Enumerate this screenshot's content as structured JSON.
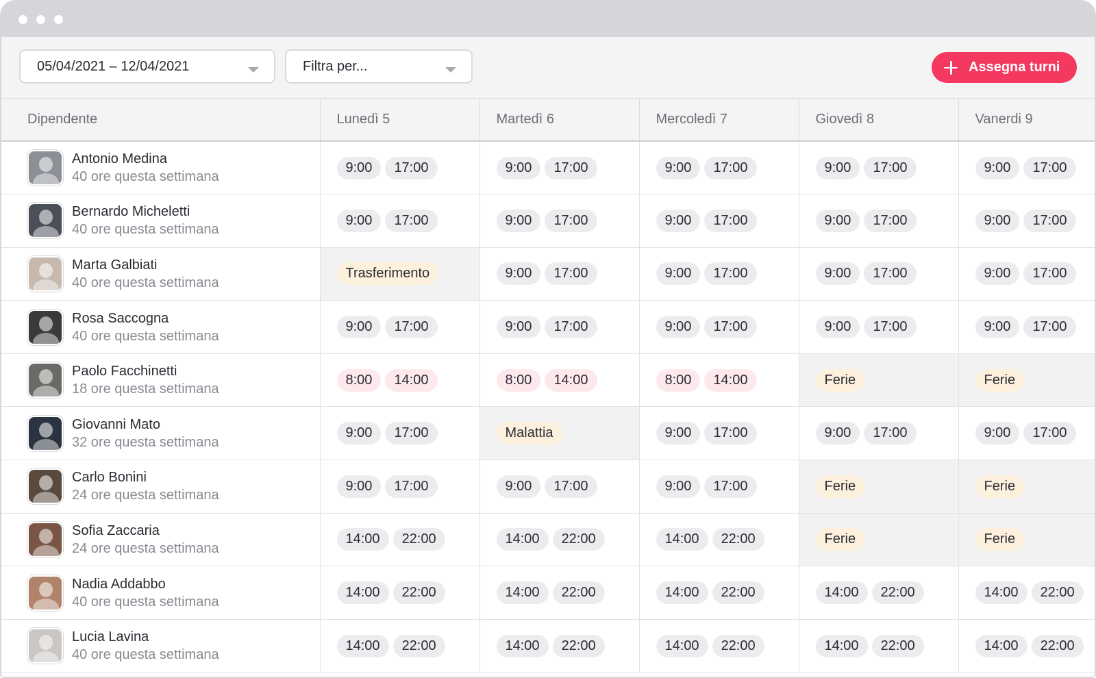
{
  "toolbar": {
    "date_range": "05/04/2021 – 12/04/2021",
    "filter_placeholder": "Filtra per...",
    "assign_label": "Assegna turni"
  },
  "colors": {
    "accent": "#f5385f",
    "pill_default": "#ececee",
    "pill_pink": "#fde8ec",
    "pill_cream": "#fdf1dd",
    "shaded_cell": "#f2f2f3"
  },
  "table": {
    "employee_header": "Dipendente",
    "days": [
      "Lunedì 5",
      "Martedì 6",
      "Mercoledì 7",
      "Giovedì 8",
      "Vanerdi 9"
    ],
    "employees": [
      {
        "name": "Antonio Medina",
        "hours": "40 ore questa settimana",
        "avatar": "avatar-photo-antonio",
        "cells": [
          [
            "9:00",
            "17:00"
          ],
          [
            "9:00",
            "17:00"
          ],
          [
            "9:00",
            "17:00"
          ],
          [
            "9:00",
            "17:00"
          ],
          [
            "9:00",
            "17:00"
          ]
        ]
      },
      {
        "name": "Bernardo Micheletti",
        "hours": "40 ore questa settimana",
        "avatar": "avatar-photo-bernardo",
        "cells": [
          [
            "9:00",
            "17:00"
          ],
          [
            "9:00",
            "17:00"
          ],
          [
            "9:00",
            "17:00"
          ],
          [
            "9:00",
            "17:00"
          ],
          [
            "9:00",
            "17:00"
          ]
        ]
      },
      {
        "name": "Marta Galbiati",
        "hours": "40 ore questa settimana",
        "avatar": "avatar-photo-marta",
        "cells": [
          [
            "Trasferimento"
          ],
          [
            "9:00",
            "17:00"
          ],
          [
            "9:00",
            "17:00"
          ],
          [
            "9:00",
            "17:00"
          ],
          [
            "9:00",
            "17:00"
          ]
        ]
      },
      {
        "name": "Rosa Saccogna",
        "hours": "40 ore questa settimana",
        "avatar": "avatar-photo-rosa",
        "cells": [
          [
            "9:00",
            "17:00"
          ],
          [
            "9:00",
            "17:00"
          ],
          [
            "9:00",
            "17:00"
          ],
          [
            "9:00",
            "17:00"
          ],
          [
            "9:00",
            "17:00"
          ]
        ]
      },
      {
        "name": "Paolo Facchinetti",
        "hours": "18 ore questa settimana",
        "avatar": "avatar-photo-paolo",
        "cells": [
          [
            "8:00",
            "14:00"
          ],
          [
            "8:00",
            "14:00"
          ],
          [
            "8:00",
            "14:00"
          ],
          [
            "Ferie"
          ],
          [
            "Ferie"
          ]
        ]
      },
      {
        "name": "Giovanni Mato",
        "hours": "32 ore questa settimana",
        "avatar": "avatar-photo-giovanni",
        "cells": [
          [
            "9:00",
            "17:00"
          ],
          [
            "Malattia"
          ],
          [
            "9:00",
            "17:00"
          ],
          [
            "9:00",
            "17:00"
          ],
          [
            "9:00",
            "17:00"
          ]
        ]
      },
      {
        "name": "Carlo Bonini",
        "hours": "24 ore questa settimana",
        "avatar": "avatar-photo-carlo",
        "cells": [
          [
            "9:00",
            "17:00"
          ],
          [
            "9:00",
            "17:00"
          ],
          [
            "9:00",
            "17:00"
          ],
          [
            "Ferie"
          ],
          [
            "Ferie"
          ]
        ]
      },
      {
        "name": "Sofia Zaccaria",
        "hours": "24 ore questa settimana",
        "avatar": "avatar-photo-sofia",
        "cells": [
          [
            "14:00",
            "22:00"
          ],
          [
            "14:00",
            "22:00"
          ],
          [
            "14:00",
            "22:00"
          ],
          [
            "Ferie"
          ],
          [
            "Ferie"
          ]
        ]
      },
      {
        "name": "Nadia Addabbo",
        "hours": "40 ore questa settimana",
        "avatar": "avatar-photo-nadia",
        "cells": [
          [
            "14:00",
            "22:00"
          ],
          [
            "14:00",
            "22:00"
          ],
          [
            "14:00",
            "22:00"
          ],
          [
            "14:00",
            "22:00"
          ],
          [
            "14:00",
            "22:00"
          ]
        ]
      },
      {
        "name": "Lucia Lavina",
        "hours": "40 ore questa settimana",
        "avatar": "avatar-photo-lucia",
        "cells": [
          [
            "14:00",
            "22:00"
          ],
          [
            "14:00",
            "22:00"
          ],
          [
            "14:00",
            "22:00"
          ],
          [
            "14:00",
            "22:00"
          ],
          [
            "14:00",
            "22:00"
          ]
        ]
      }
    ]
  }
}
